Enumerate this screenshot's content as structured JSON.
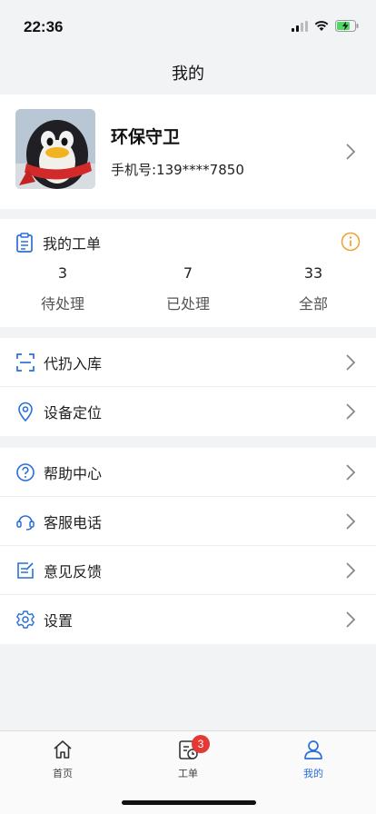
{
  "status_bar": {
    "time": "22:36"
  },
  "nav": {
    "title": "我的"
  },
  "profile": {
    "name": "环保守卫",
    "phone": "手机号:139****7850"
  },
  "orders": {
    "title": "我的工单",
    "stats": [
      {
        "count": "3",
        "label": "待处理"
      },
      {
        "count": "7",
        "label": "已处理"
      },
      {
        "count": "33",
        "label": "全部"
      }
    ]
  },
  "menu_group_1": [
    {
      "label": "代扔入库",
      "icon": "scan-icon"
    },
    {
      "label": "设备定位",
      "icon": "location-pin-icon"
    }
  ],
  "menu_group_2": [
    {
      "label": "帮助中心",
      "icon": "help-icon"
    },
    {
      "label": "客服电话",
      "icon": "headset-icon"
    },
    {
      "label": "意见反馈",
      "icon": "feedback-icon"
    },
    {
      "label": "设置",
      "icon": "gear-icon"
    }
  ],
  "tab_bar": {
    "tabs": [
      {
        "label": "首页",
        "icon": "home-icon"
      },
      {
        "label": "工单",
        "icon": "clipboard-clock-icon",
        "badge": "3"
      },
      {
        "label": "我的",
        "icon": "user-icon",
        "active": true
      }
    ]
  },
  "colors": {
    "accent": "#2a6fd8",
    "badge": "#e53935",
    "info": "#f0a030",
    "battery": "#4cd964"
  }
}
